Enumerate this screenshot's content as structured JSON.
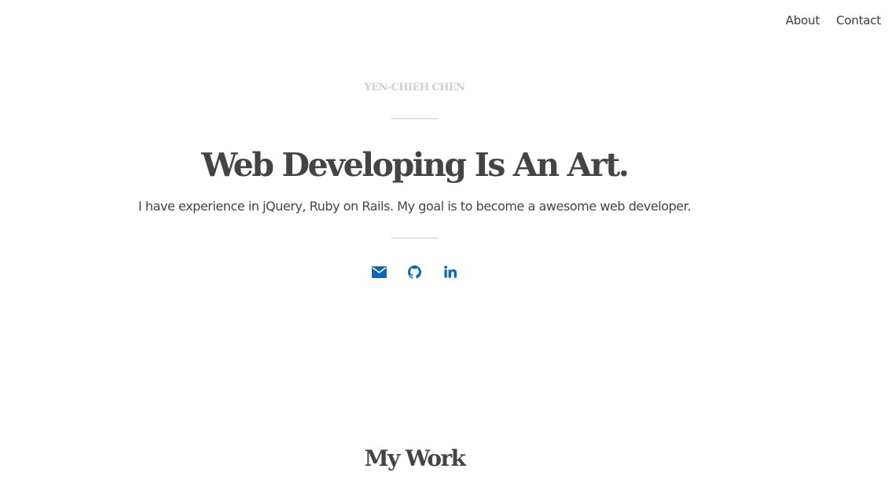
{
  "nav": {
    "about_label": "About",
    "contact_label": "Contact"
  },
  "hero": {
    "site_name": "YEN-CHIEH CHEN",
    "headline": "Web Developing Is An Art.",
    "tagline": "I have experience in jQuery, Ruby on Rails. My goal is to become a awesome web developer."
  },
  "social": {
    "icons": [
      "envelope-icon",
      "github-icon",
      "linkedin-icon"
    ],
    "color": "#0a6ab8"
  },
  "work": {
    "title": "My Work"
  }
}
